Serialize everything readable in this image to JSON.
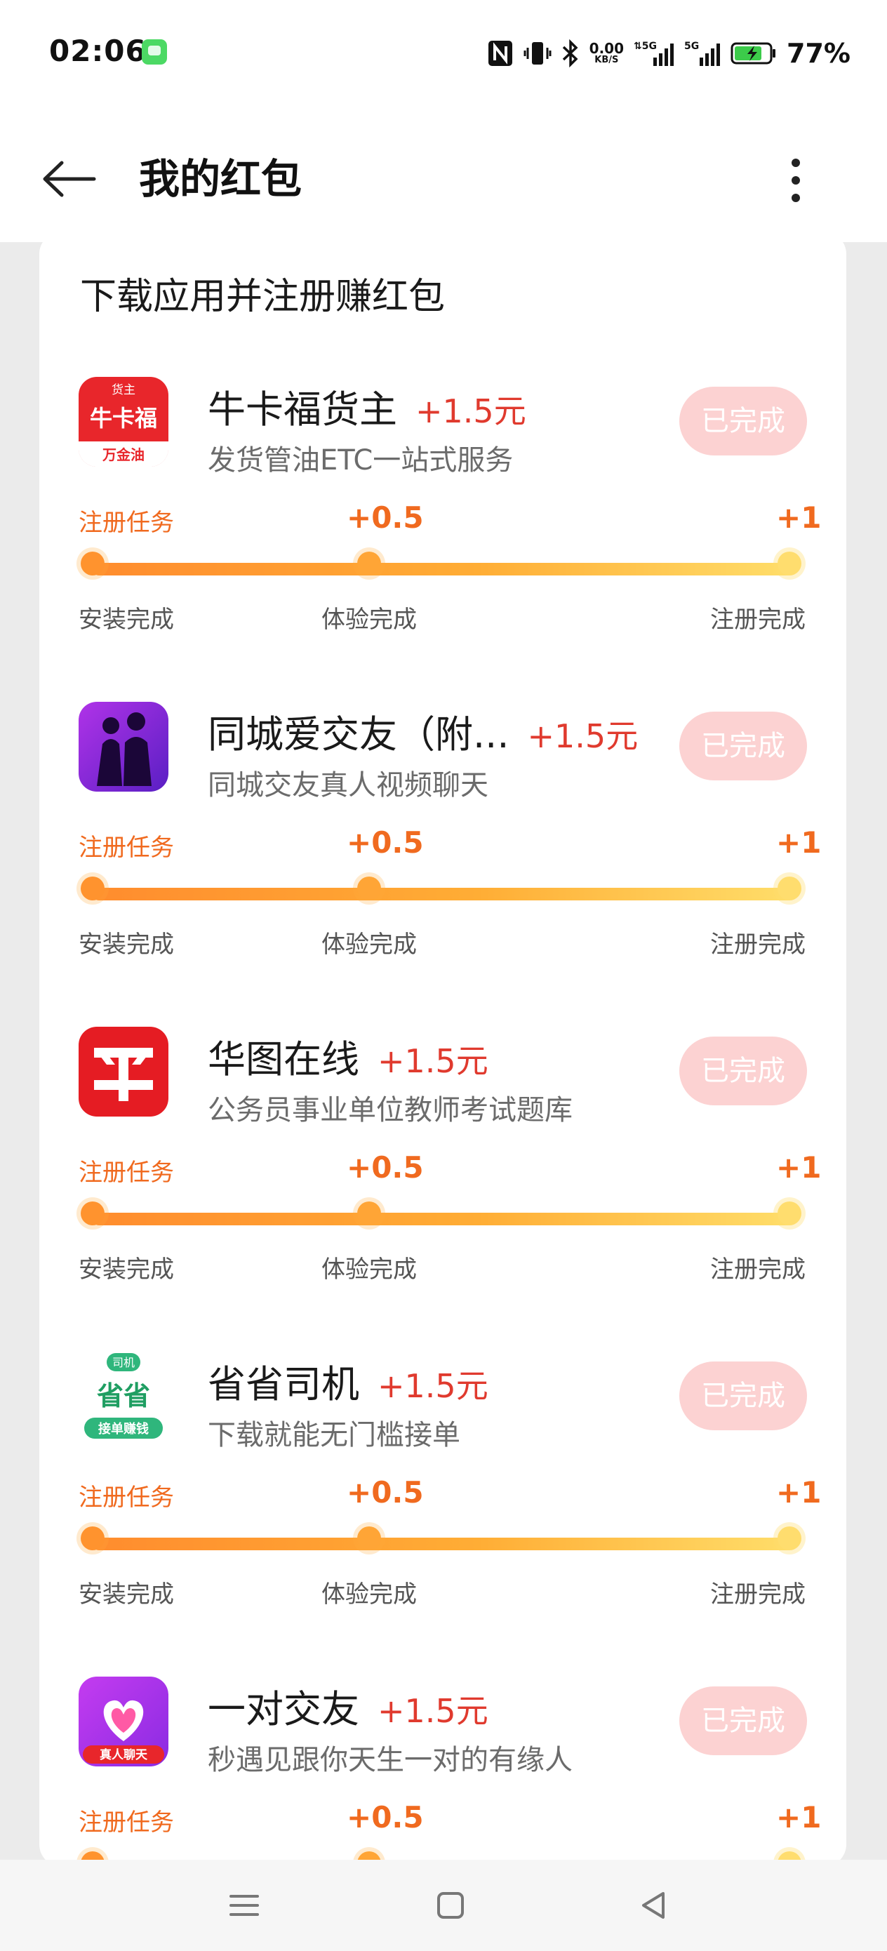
{
  "status_bar": {
    "time": "02:06",
    "net_speed_value": "0.00",
    "net_speed_unit": "KB/S",
    "battery_pct": "77%"
  },
  "header": {
    "title": "我的红包"
  },
  "section": {
    "title": "下载应用并注册赚红包"
  },
  "common": {
    "done_label": "已完成",
    "task_label": "注册任务",
    "mid_reward": "+0.5",
    "end_reward": "+1",
    "step_install": "安装完成",
    "step_experience": "体验完成",
    "step_register": "注册完成"
  },
  "tasks": [
    {
      "name": "牛卡福货主",
      "reward": "+1.5元",
      "desc": "发货管油ETC一站式服务",
      "icon": "niukafu-app-icon",
      "icon_text": {
        "top": "货主",
        "mid": "牛卡福",
        "bottom": "万金油"
      }
    },
    {
      "name": "同城爱交友（附...",
      "reward": "+1.5元",
      "desc": "同城交友真人视频聊天",
      "icon": "tongcheng-app-icon"
    },
    {
      "name": "华图在线",
      "reward": "+1.5元",
      "desc": "公务员事业单位教师考试题库",
      "icon": "huatu-app-icon"
    },
    {
      "name": "省省司机",
      "reward": "+1.5元",
      "desc": "下载就能无门槛接单",
      "icon": "shengsheng-app-icon",
      "icon_text": {
        "top": "司机",
        "mid": "省省",
        "bottom": "接单赚钱"
      }
    },
    {
      "name": "一对交友",
      "reward": "+1.5元",
      "desc": "秒遇见跟你天生一对的有缘人",
      "icon": "yidui-app-icon",
      "icon_text": {
        "bottom": "真人聊天"
      }
    }
  ],
  "colors": {
    "accent_orange": "#f06a1f",
    "reward_red": "#e03a2e",
    "done_button_bg": "#fcd2d2",
    "progress_start": "#ff8c2e",
    "progress_end": "#ffde6a"
  }
}
